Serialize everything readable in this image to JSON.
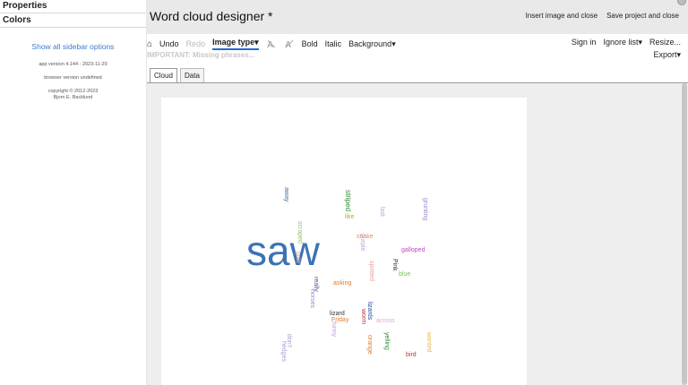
{
  "sidebar": {
    "sections": [
      "Properties",
      "Colors"
    ],
    "show_all_link": "Show all sidebar options",
    "app_version": "app version 4.144 - 2023-11-29",
    "browser_version": "browser version undefined",
    "copyright_line1": "copyright © 2012-2023",
    "copyright_line2": "Bjorn E. Backlund"
  },
  "header": {
    "title": "Word cloud designer *",
    "insert_label": "Insert image and close",
    "save_label": "Save project and close"
  },
  "toolbar": {
    "undo": "Undo",
    "redo": "Redo",
    "image_type": "Image type▾",
    "bold": "Bold",
    "italic": "Italic",
    "background": "Background▾",
    "sign_in": "Sign in",
    "ignore_list": "Ignore list▾",
    "resize": "Resize...",
    "export": "Export▾",
    "warning": "IMPORTANT: Missing phrases..."
  },
  "tabs": [
    {
      "label": "Cloud",
      "active": true
    },
    {
      "label": "Data",
      "active": false
    }
  ],
  "cloud_words": [
    {
      "text": "saw",
      "color": "#3c73b4"
    },
    {
      "text": "striped",
      "color": "#2e8b2e"
    },
    {
      "text": "like",
      "color": "#c9a227"
    },
    {
      "text": "last",
      "color": "#9ab4d8"
    },
    {
      "text": "grunting",
      "color": "#9e86c8"
    },
    {
      "text": "away",
      "color": "#3c6fb0"
    },
    {
      "text": "scraped",
      "color": "#8fc46a"
    },
    {
      "text": "snake",
      "color": "#e08a6a"
    },
    {
      "text": "galloped",
      "color": "#c04ac0"
    },
    {
      "text": "Pink",
      "color": "#333333"
    },
    {
      "text": "blue",
      "color": "#7ac15b"
    },
    {
      "text": "asking",
      "color": "#e07a2a"
    },
    {
      "text": "really",
      "color": "#5a4a9a"
    },
    {
      "text": "horses",
      "color": "#9a8ac8"
    },
    {
      "text": "lizard",
      "color": "#333333"
    },
    {
      "text": "Friday",
      "color": "#e07a2a"
    },
    {
      "text": "across",
      "color": "#e8a8c8"
    },
    {
      "text": "lizards",
      "color": "#1a4a9a"
    },
    {
      "text": "worm",
      "color": "#c03030"
    },
    {
      "text": "orange",
      "color": "#e07a2a"
    },
    {
      "text": "yelling",
      "color": "#2e8b2e"
    },
    {
      "text": "bird",
      "color": "#c03030"
    },
    {
      "text": "hedges",
      "color": "#a0a0e0"
    },
    {
      "text": "spotted",
      "color": "#e8a0a0"
    },
    {
      "text": "don't",
      "color": "#a0a0d0"
    },
    {
      "text": "wanted",
      "color": "#e8c050"
    },
    {
      "text": "purple",
      "color": "#c0a0e0"
    },
    {
      "text": "pale",
      "color": "#e8a0a0"
    },
    {
      "text": "funny",
      "color": "#c0a0e0"
    }
  ]
}
